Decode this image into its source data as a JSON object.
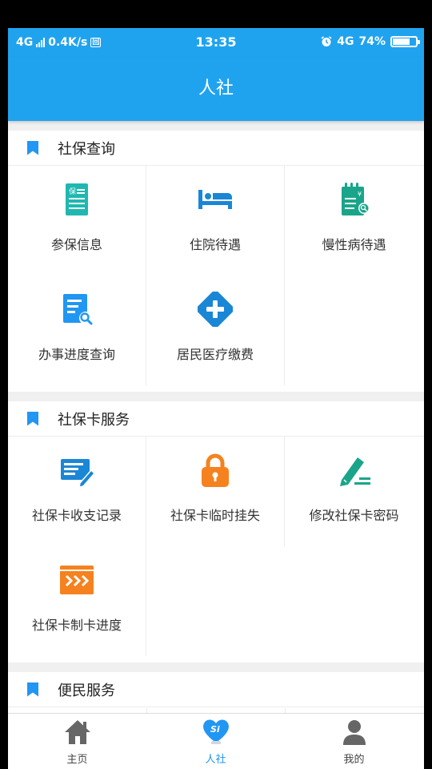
{
  "status_bar": {
    "network": "4G",
    "speed": "0.4K/s",
    "sim": "回",
    "time": "13:35",
    "net_right": "4G",
    "battery_level": "74%",
    "battery_fraction": 0.74
  },
  "app_bar": {
    "title": "人社"
  },
  "sections": [
    {
      "title": "社保查询",
      "items": [
        {
          "label": "参保信息",
          "icon": "insurance-document-icon"
        },
        {
          "label": "住院待遇",
          "icon": "hospital-bed-icon"
        },
        {
          "label": "慢性病待遇",
          "icon": "chronic-notepad-icon"
        },
        {
          "label": "办事进度查询",
          "icon": "progress-search-icon"
        },
        {
          "label": "居民医疗缴费",
          "icon": "medical-cross-icon"
        }
      ]
    },
    {
      "title": "社保卡服务",
      "items": [
        {
          "label": "社保卡收支记录",
          "icon": "card-record-icon"
        },
        {
          "label": "社保卡临时挂失",
          "icon": "lock-icon"
        },
        {
          "label": "修改社保卡密码",
          "icon": "edit-pen-icon"
        },
        {
          "label": "社保卡制卡进度",
          "icon": "card-progress-icon"
        }
      ]
    },
    {
      "title": "便民服务",
      "items": []
    }
  ],
  "bottom_nav": [
    {
      "label": "主页",
      "icon": "home-icon",
      "active": false
    },
    {
      "label": "人社",
      "icon": "si-heart-icon",
      "active": true
    },
    {
      "label": "我的",
      "icon": "person-icon",
      "active": false
    }
  ],
  "colors": {
    "primary": "#20a3ef",
    "accent_blue": "#2196f3",
    "teal": "#1fb8b0",
    "orange": "#f5821f",
    "green": "#1aa58a"
  }
}
